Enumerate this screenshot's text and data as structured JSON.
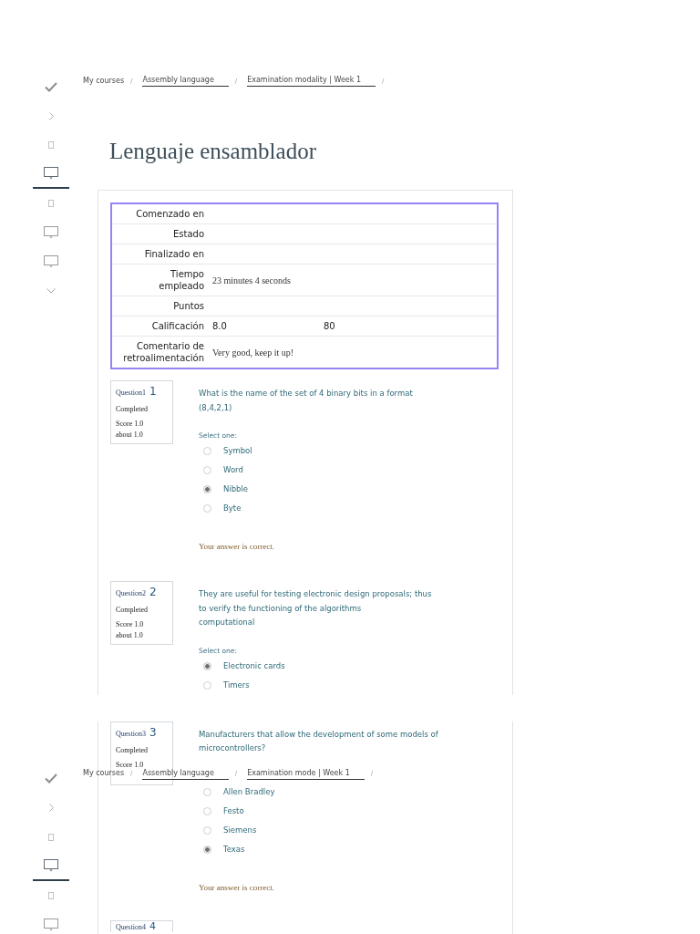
{
  "views": [
    {
      "sidebar": {
        "items": [
          {
            "kind": "check",
            "selected": false
          },
          {
            "kind": "chevron-right",
            "selected": false
          },
          {
            "kind": "page",
            "selected": false
          },
          {
            "kind": "monitor",
            "selected": true
          },
          {
            "kind": "page",
            "selected": false
          },
          {
            "kind": "monitor",
            "selected": false
          },
          {
            "kind": "monitor",
            "selected": false
          },
          {
            "kind": "chevron-down",
            "selected": false
          }
        ]
      },
      "breadcrumb": [
        {
          "label": "My courses",
          "underlined": false,
          "separator": "/"
        },
        {
          "label": "Assembly language",
          "underlined": true,
          "separator": "/"
        },
        {
          "label": "Examination modality | Week 1",
          "underlined": true,
          "separator": "/"
        }
      ],
      "title": "Lenguaje ensamblador",
      "summary_table": {
        "rows": [
          {
            "label": "Comenzado en"
          },
          {
            "label": "Estado"
          },
          {
            "label": "Finalizado en"
          },
          {
            "label": "Tiempo\nempleado",
            "values": [
              {
                "text": "23 minutes 4 seconds",
                "kind": "text"
              }
            ]
          },
          {
            "label": "Puntos"
          },
          {
            "label": "Calificación",
            "values": [
              {
                "text": "8.0",
                "kind": "number"
              },
              {
                "text": "80",
                "kind": "number"
              }
            ]
          },
          {
            "label": "Comentario de\nretroalimentación",
            "values": [
              {
                "text": "Very good, keep it up!",
                "kind": "text"
              }
            ]
          }
        ]
      },
      "questions": [
        {
          "label": "Question1",
          "number": "1",
          "status": "Completed",
          "score": "Score 1.0",
          "out_of": "about 1.0",
          "text": "What is the name of the set of 4 binary bits in a format\n(8,4,2,1)",
          "prompt": "Select one:",
          "options": [
            {
              "label": "Symbol",
              "selected": false
            },
            {
              "label": "Word",
              "selected": false
            },
            {
              "label": "Nibble",
              "selected": true
            },
            {
              "label": "Byte",
              "selected": false
            }
          ],
          "feedback": "Your answer is correct."
        },
        {
          "label": "Question2",
          "number": "2",
          "status": "Completed",
          "score": "Score 1.0",
          "out_of": "about 1.0",
          "text": "They are useful for testing electronic design proposals; thus\nto verify the functioning of the algorithms\ncomputational",
          "prompt": "Select one:",
          "options": [
            {
              "label": "Electronic cards",
              "selected": true
            },
            {
              "label": "Timers",
              "selected": false
            }
          ]
        }
      ]
    },
    {
      "sidebar": {
        "items": [
          {
            "kind": "check",
            "selected": false
          },
          {
            "kind": "chevron-right",
            "selected": false
          },
          {
            "kind": "page",
            "selected": false
          },
          {
            "kind": "monitor",
            "selected": true
          },
          {
            "kind": "page",
            "selected": false
          },
          {
            "kind": "monitor",
            "selected": false
          }
        ]
      },
      "breadcrumb": [
        {
          "label": "My courses",
          "underlined": false,
          "separator": "/"
        },
        {
          "label": "Assembly language",
          "underlined": true,
          "separator": "/"
        },
        {
          "label": "Examination mode | Week 1",
          "underlined": true,
          "separator": "/"
        }
      ],
      "questions": [
        {
          "label": "Question3",
          "number": "3",
          "status": "Completed",
          "score": "Score 1.0",
          "text": "Manufacturers that allow the development of some models of\nmicrocontrollers?",
          "options": [
            {
              "label": "Allen Bradley",
              "selected": false
            },
            {
              "label": "Festo",
              "selected": false
            },
            {
              "label": "Siemens",
              "selected": false
            },
            {
              "label": "Texas",
              "selected": true
            }
          ],
          "feedback": "Your answer is correct."
        },
        {
          "label": "Question4",
          "number": "4"
        }
      ]
    }
  ]
}
